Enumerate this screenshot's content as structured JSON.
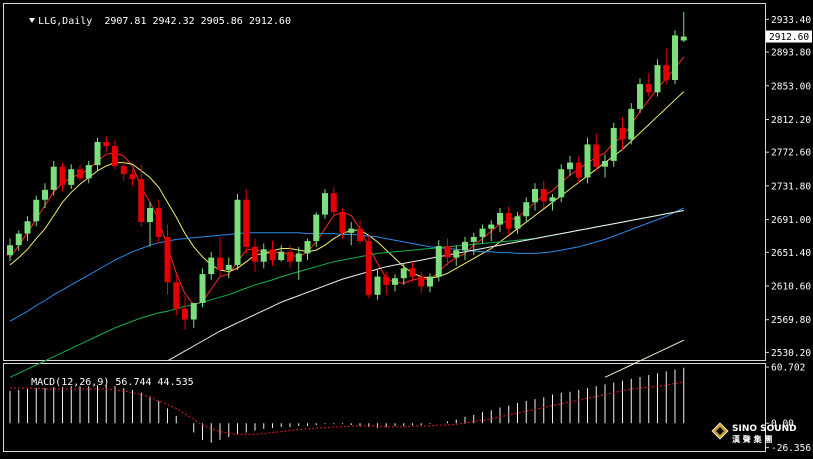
{
  "header": {
    "symbol": "LLG,Daily",
    "ohlc": "2907.81 2942.32 2905.86 2912.60",
    "macd_label": "MACD(12,26,9) 56.744 44.535"
  },
  "colors": {
    "background": "#000000",
    "frame": "#d8d8d8",
    "up": "#7dde7d",
    "down": "#e40000",
    "ma_red": "#ff2a2a",
    "ma_yellow": "#f2ef6e",
    "ma_blue": "#2d8be6",
    "ma_green": "#16b34a",
    "ma_white": "#f0f0f0",
    "ma_white2": "#f7f2c8",
    "macd_hist": "#f2f2f2",
    "macd_signal": "#e02020"
  },
  "logo": {
    "line1": "SINO SOUND",
    "line2": "漢 聲 集 團",
    "icon": "diamond-logo-icon"
  },
  "chart_data": {
    "type": "candlestick",
    "title": "LLG,Daily",
    "price_axis": {
      "ylim": [
        2521,
        2952
      ],
      "ticks": [
        "2933.40",
        "2893.80",
        "2853.00",
        "2812.20",
        "2772.60",
        "2731.80",
        "2691.00",
        "2651.40",
        "2610.60",
        "2569.80",
        "2530.20"
      ],
      "current_price": "2912.60"
    },
    "candles": [
      [
        2648,
        2668,
        2641,
        2660
      ],
      [
        2660,
        2678,
        2653,
        2674
      ],
      [
        2674,
        2695,
        2665,
        2689
      ],
      [
        2689,
        2720,
        2683,
        2715
      ],
      [
        2715,
        2735,
        2705,
        2727
      ],
      [
        2727,
        2762,
        2720,
        2755
      ],
      [
        2755,
        2760,
        2725,
        2733
      ],
      [
        2733,
        2758,
        2728,
        2752
      ],
      [
        2752,
        2757,
        2738,
        2741
      ],
      [
        2741,
        2762,
        2735,
        2757
      ],
      [
        2757,
        2790,
        2750,
        2785
      ],
      [
        2785,
        2792,
        2772,
        2780
      ],
      [
        2780,
        2788,
        2752,
        2756
      ],
      [
        2756,
        2762,
        2738,
        2746
      ],
      [
        2746,
        2752,
        2732,
        2740
      ],
      [
        2740,
        2758,
        2683,
        2688
      ],
      [
        2688,
        2712,
        2658,
        2705
      ],
      [
        2705,
        2715,
        2662,
        2670
      ],
      [
        2670,
        2685,
        2600,
        2615
      ],
      [
        2615,
        2625,
        2575,
        2583
      ],
      [
        2583,
        2598,
        2558,
        2570
      ],
      [
        2570,
        2580,
        2560,
        2590
      ],
      [
        2590,
        2632,
        2585,
        2625
      ],
      [
        2625,
        2652,
        2618,
        2645
      ],
      [
        2645,
        2670,
        2622,
        2630
      ],
      [
        2630,
        2645,
        2620,
        2636
      ],
      [
        2636,
        2722,
        2630,
        2715
      ],
      [
        2715,
        2728,
        2650,
        2658
      ],
      [
        2658,
        2668,
        2628,
        2640
      ],
      [
        2640,
        2662,
        2632,
        2655
      ],
      [
        2655,
        2665,
        2635,
        2642
      ],
      [
        2642,
        2660,
        2640,
        2652
      ],
      [
        2652,
        2660,
        2633,
        2640
      ],
      [
        2640,
        2658,
        2618,
        2650
      ],
      [
        2650,
        2668,
        2642,
        2665
      ],
      [
        2665,
        2700,
        2658,
        2697
      ],
      [
        2697,
        2728,
        2692,
        2723
      ],
      [
        2723,
        2730,
        2695,
        2700
      ],
      [
        2700,
        2705,
        2668,
        2675
      ],
      [
        2675,
        2688,
        2660,
        2680
      ],
      [
        2680,
        2690,
        2662,
        2665
      ],
      [
        2665,
        2672,
        2596,
        2600
      ],
      [
        2600,
        2630,
        2594,
        2622
      ],
      [
        2622,
        2628,
        2600,
        2612
      ],
      [
        2612,
        2625,
        2604,
        2620
      ],
      [
        2620,
        2638,
        2612,
        2632
      ],
      [
        2632,
        2640,
        2615,
        2622
      ],
      [
        2622,
        2628,
        2602,
        2610
      ],
      [
        2610,
        2626,
        2603,
        2622
      ],
      [
        2622,
        2666,
        2616,
        2659
      ],
      [
        2659,
        2668,
        2635,
        2645
      ],
      [
        2645,
        2660,
        2635,
        2654
      ],
      [
        2654,
        2670,
        2642,
        2664
      ],
      [
        2664,
        2675,
        2648,
        2670
      ],
      [
        2670,
        2685,
        2662,
        2680
      ],
      [
        2680,
        2690,
        2665,
        2685
      ],
      [
        2685,
        2705,
        2676,
        2699
      ],
      [
        2699,
        2707,
        2672,
        2680
      ],
      [
        2680,
        2700,
        2674,
        2695
      ],
      [
        2695,
        2718,
        2688,
        2712
      ],
      [
        2712,
        2735,
        2702,
        2728
      ],
      [
        2728,
        2738,
        2705,
        2713
      ],
      [
        2713,
        2722,
        2702,
        2718
      ],
      [
        2718,
        2758,
        2712,
        2752
      ],
      [
        2752,
        2768,
        2744,
        2760
      ],
      [
        2760,
        2768,
        2735,
        2742
      ],
      [
        2742,
        2790,
        2735,
        2782
      ],
      [
        2782,
        2795,
        2750,
        2755
      ],
      [
        2755,
        2770,
        2742,
        2762
      ],
      [
        2762,
        2808,
        2755,
        2802
      ],
      [
        2802,
        2815,
        2775,
        2788
      ],
      [
        2788,
        2832,
        2782,
        2825
      ],
      [
        2825,
        2862,
        2820,
        2855
      ],
      [
        2855,
        2868,
        2840,
        2845
      ],
      [
        2845,
        2885,
        2840,
        2878
      ],
      [
        2878,
        2898,
        2855,
        2860
      ],
      [
        2860,
        2920,
        2855,
        2914
      ],
      [
        2907.81,
        2942.32,
        2905.86,
        2912.6
      ]
    ],
    "ma_series": [
      {
        "color": "#ff2a2a",
        "values": [
          2645,
          2660,
          2675,
          2692,
          2708,
          2725,
          2735,
          2742,
          2746,
          2752,
          2762,
          2770,
          2772,
          2768,
          2756,
          2730,
          2712,
          2690,
          2658,
          2626,
          2601,
          2588,
          2592,
          2607,
          2622,
          2625,
          2640,
          2654,
          2656,
          2650,
          2650,
          2652,
          2648,
          2646,
          2652,
          2664,
          2680,
          2696,
          2700,
          2696,
          2680,
          2658,
          2638,
          2620,
          2615,
          2614,
          2618,
          2620,
          2618,
          2628,
          2638,
          2645,
          2650,
          2660,
          2668,
          2677,
          2686,
          2690,
          2694,
          2702,
          2712,
          2720,
          2726,
          2736,
          2745,
          2752,
          2760,
          2766,
          2772,
          2784,
          2792,
          2806,
          2822,
          2836,
          2850,
          2862,
          2874,
          2888
        ]
      },
      {
        "color": "#f2ef6e",
        "values": [
          2636,
          2645,
          2655,
          2668,
          2680,
          2696,
          2712,
          2724,
          2734,
          2742,
          2750,
          2756,
          2760,
          2760,
          2758,
          2750,
          2742,
          2730,
          2712,
          2694,
          2674,
          2658,
          2646,
          2636,
          2630,
          2628,
          2632,
          2640,
          2648,
          2650,
          2653,
          2656,
          2656,
          2654,
          2652,
          2654,
          2660,
          2668,
          2674,
          2678,
          2678,
          2672,
          2664,
          2654,
          2644,
          2634,
          2626,
          2622,
          2620,
          2622,
          2626,
          2632,
          2638,
          2644,
          2650,
          2656,
          2664,
          2672,
          2680,
          2688,
          2696,
          2704,
          2712,
          2720,
          2728,
          2736,
          2744,
          2752,
          2760,
          2768,
          2776,
          2786,
          2796,
          2806,
          2816,
          2826,
          2836,
          2846
        ]
      },
      {
        "color": "#2d8be6",
        "values": [
          2568,
          2574,
          2580,
          2587,
          2593,
          2600,
          2606,
          2612,
          2618,
          2624,
          2630,
          2636,
          2642,
          2647,
          2652,
          2656,
          2660,
          2663,
          2665,
          2667,
          2668,
          2669,
          2670,
          2671,
          2672,
          2673,
          2674,
          2675,
          2675,
          2675,
          2675,
          2675,
          2675,
          2675,
          2674,
          2674,
          2674,
          2674,
          2673,
          2673,
          2672,
          2671,
          2670,
          2668,
          2666,
          2664,
          2662,
          2660,
          2658,
          2657,
          2656,
          2655,
          2654,
          2653,
          2652,
          2652,
          2651,
          2651,
          2650,
          2650,
          2650,
          2651,
          2652,
          2654,
          2656,
          2658,
          2661,
          2664,
          2667,
          2671,
          2675,
          2679,
          2683,
          2687,
          2691,
          2695,
          2700,
          2705
        ]
      },
      {
        "color": "#16b34a",
        "values": [
          2500,
          2505,
          2510,
          2515,
          2520,
          2525,
          2530,
          2535,
          2540,
          2545,
          2550,
          2555,
          2560,
          2564,
          2568,
          2572,
          2575,
          2578,
          2580,
          2583,
          2586,
          2588,
          2591,
          2594,
          2597,
          2600,
          2604,
          2608,
          2612,
          2615,
          2618,
          2622,
          2625,
          2628,
          2631,
          2634,
          2637,
          2640,
          2642,
          2644,
          2646,
          2648,
          2650,
          2651,
          2652,
          2653,
          2654,
          2655,
          2656,
          2657,
          2658,
          2659,
          2660,
          2661,
          2662,
          2663,
          2664,
          2665,
          2666,
          2667,
          2668,
          2670,
          2672,
          2674,
          2676,
          2678,
          2680,
          2682,
          2684,
          2686,
          2688,
          2690,
          2692,
          2694,
          2696,
          2698,
          2700,
          2702
        ]
      },
      {
        "color": "#f0f0f0",
        "values": [
          null,
          null,
          null,
          null,
          null,
          null,
          null,
          null,
          null,
          null,
          null,
          null,
          null,
          null,
          null,
          null,
          null,
          null,
          2520,
          2526,
          2532,
          2538,
          2544,
          2550,
          2556,
          2561,
          2566,
          2571,
          2576,
          2581,
          2586,
          2591,
          2595,
          2599,
          2603,
          2607,
          2611,
          2615,
          2619,
          2622,
          2625,
          2628,
          2631,
          2634,
          2636,
          2638,
          2640,
          2642,
          2644,
          2646,
          2648,
          2650,
          2652,
          2654,
          2656,
          2658,
          2660,
          2662,
          2664,
          2666,
          2668,
          2670,
          2672,
          2674,
          2676,
          2678,
          2680,
          2682,
          2684,
          2686,
          2688,
          2690,
          2692,
          2694,
          2696,
          2698,
          2700,
          2702
        ]
      },
      {
        "color": "#f7f2c8",
        "values": [
          null,
          null,
          null,
          null,
          null,
          null,
          null,
          null,
          null,
          null,
          null,
          null,
          null,
          null,
          null,
          null,
          null,
          null,
          null,
          null,
          null,
          null,
          null,
          null,
          null,
          null,
          null,
          null,
          null,
          null,
          null,
          null,
          null,
          null,
          null,
          null,
          null,
          null,
          null,
          null,
          null,
          null,
          null,
          null,
          null,
          null,
          null,
          null,
          null,
          null,
          null,
          null,
          null,
          null,
          null,
          null,
          null,
          null,
          null,
          null,
          null,
          null,
          null,
          null,
          null,
          null,
          null,
          null,
          2500,
          2505,
          2510,
          2515,
          2520,
          2525,
          2530,
          2535,
          2540,
          2545
        ]
      }
    ],
    "macd": {
      "name": "MACD(12,26,9)",
      "ylim": [
        -30,
        64
      ],
      "ticks": [
        "60.702",
        "0.00",
        "-26.356"
      ],
      "histogram": [
        35,
        36,
        37,
        38,
        38,
        39,
        39,
        40,
        40,
        40,
        41,
        41,
        40,
        38,
        36,
        33,
        29,
        24,
        16,
        8,
        0,
        -10,
        -18,
        -21,
        -18,
        -15,
        -12,
        -10,
        -8,
        -6,
        -5,
        -4,
        -4,
        -3,
        -3,
        -2,
        -1,
        -1,
        -1,
        -2,
        -3,
        -4,
        -5,
        -4,
        -3,
        -3,
        -2,
        -2,
        -1,
        0,
        2,
        4,
        7,
        9,
        12,
        14,
        17,
        19,
        22,
        24,
        26,
        28,
        31,
        33,
        34,
        36,
        38,
        40,
        42,
        44,
        46,
        48,
        50,
        52,
        54,
        56,
        58,
        60
      ],
      "signal": [
        38,
        38,
        38,
        38,
        37,
        37,
        37,
        37,
        37,
        37,
        37,
        37,
        36,
        35,
        33,
        31,
        28,
        24,
        20,
        16,
        10,
        4,
        -2,
        -6,
        -9,
        -11,
        -12,
        -12,
        -12,
        -11,
        -10,
        -9,
        -8,
        -7,
        -6,
        -5,
        -5,
        -4,
        -4,
        -3,
        -3,
        -3,
        -3,
        -4,
        -4,
        -4,
        -3,
        -3,
        -3,
        -2,
        -2,
        -1,
        0,
        2,
        3,
        5,
        7,
        9,
        11,
        13,
        15,
        17,
        19,
        21,
        23,
        25,
        27,
        29,
        31,
        33,
        35,
        37,
        38,
        39,
        40,
        41,
        43,
        44.5
      ]
    }
  }
}
